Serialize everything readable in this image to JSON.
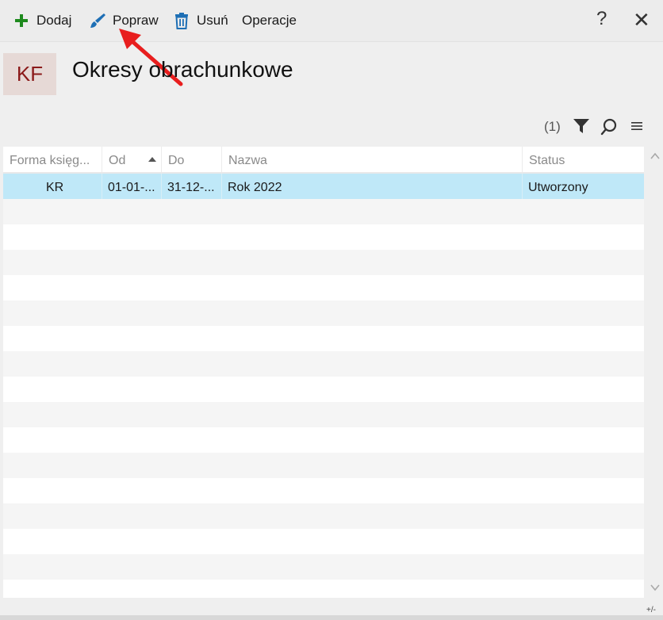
{
  "toolbar": {
    "add_label": "Dodaj",
    "edit_label": "Popraw",
    "delete_label": "Usuń",
    "operations_label": "Operacje",
    "help_label": "?",
    "close_label": "✕"
  },
  "header": {
    "tile_text": "KF",
    "title": "Okresy obrachunkowe"
  },
  "filter_bar": {
    "count": "(1)"
  },
  "grid": {
    "columns": [
      "Forma księg...",
      "Od",
      "Do",
      "Nazwa",
      "Status"
    ],
    "rows": [
      {
        "form": "KR",
        "from": "01-01-...",
        "to": "31-12-...",
        "name": "Rok 2022",
        "status": "Utworzony",
        "selected": true
      }
    ]
  },
  "footer": {
    "corner_text": "+/-"
  },
  "colors": {
    "selected_row": "#bfe8f8",
    "tile_bg": "#e6d9d6",
    "tile_text": "#8b1a1a",
    "add_icon": "#1e8a1e",
    "edit_icon": "#1e6fb5",
    "delete_icon": "#1e6fb5",
    "annotation": "#e81e1e"
  }
}
